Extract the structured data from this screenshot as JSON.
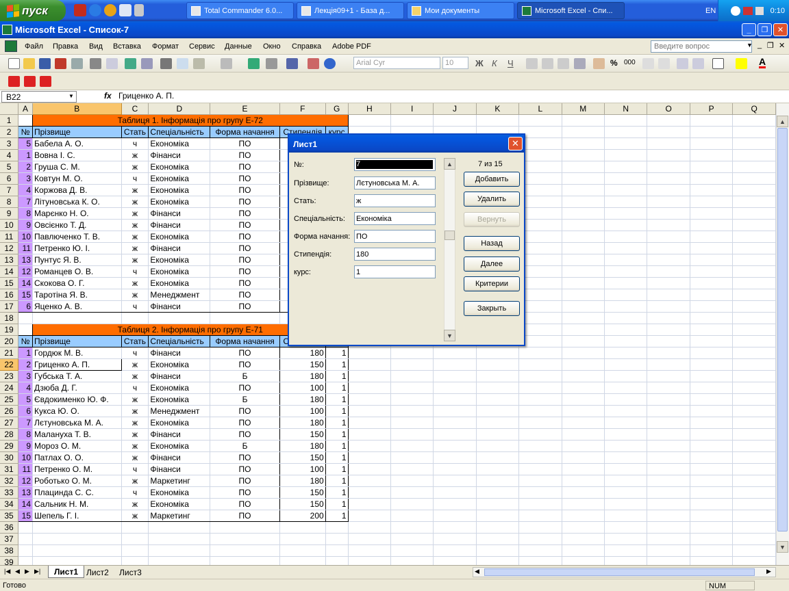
{
  "taskbar": {
    "start_label": "пуск",
    "tasks": [
      {
        "label": "Total Commander 6.0...",
        "active": false
      },
      {
        "label": "Лекція09+1 - База д...",
        "active": false
      },
      {
        "label": "Мои документы",
        "active": false
      },
      {
        "label": "Microsoft Excel - Спи...",
        "active": true
      }
    ],
    "lang": "EN",
    "clock": "0:10"
  },
  "window": {
    "title": "Microsoft Excel - Список-7"
  },
  "menubar": {
    "items": [
      "Файл",
      "Правка",
      "Вид",
      "Вставка",
      "Формат",
      "Сервис",
      "Данные",
      "Окно",
      "Справка",
      "Adobe PDF"
    ],
    "ask_placeholder": "Введите вопрос"
  },
  "toolbar": {
    "font": "Arial Cyr",
    "size": "10"
  },
  "formula_bar": {
    "name_box": "B22",
    "fx": "fx",
    "value": "Гриценко А. П."
  },
  "grid": {
    "columns": [
      "A",
      "B",
      "C",
      "D",
      "E",
      "F",
      "G",
      "H",
      "I",
      "J",
      "K",
      "L",
      "M",
      "N",
      "O",
      "P",
      "Q"
    ],
    "table1_title": "Таблиця 1. Інформація про групу Е-72",
    "table2_title": "Таблиця 2. Інформація про групу Е-71",
    "headers": [
      "№",
      "Прізвище",
      "Стать",
      "Спеціальність",
      "Форма начання",
      "Стипендія",
      "курс"
    ],
    "table1_rows": [
      [
        "5",
        "Бабела А. О.",
        "ч",
        "Економіка",
        "ПО"
      ],
      [
        "1",
        "Вовна І. С.",
        "ж",
        "Фінанси",
        "ПО"
      ],
      [
        "2",
        "Груша С. М.",
        "ж",
        "Економіка",
        "ПО"
      ],
      [
        "3",
        "Ковтун М. О.",
        "ч",
        "Економіка",
        "ПО"
      ],
      [
        "4",
        "Коржова Д. В.",
        "ж",
        "Економіка",
        "ПО"
      ],
      [
        "7",
        "Літуновська К. О.",
        "ж",
        "Економіка",
        "ПО"
      ],
      [
        "8",
        "Марєнко Н. О.",
        "ж",
        "Фінанси",
        "ПО"
      ],
      [
        "9",
        "Овсієнко Т. Д.",
        "ж",
        "Фінанси",
        "ПО"
      ],
      [
        "10",
        "Павлюченко Т. В.",
        "ж",
        "Економіка",
        "ПО"
      ],
      [
        "11",
        "Петренко Ю. І.",
        "ж",
        "Фінанси",
        "ПО"
      ],
      [
        "13",
        "Пунтус Я. В.",
        "ж",
        "Економіка",
        "ПО"
      ],
      [
        "12",
        "Романцев О. В.",
        "ч",
        "Економіка",
        "ПО"
      ],
      [
        "14",
        "Скокова О. Г.",
        "ж",
        "Економіка",
        "ПО"
      ],
      [
        "15",
        "Таротіна Я. В.",
        "ж",
        "Менеджмент",
        "ПО"
      ],
      [
        "6",
        "Яценко А. В.",
        "ч",
        "Фінанси",
        "ПО"
      ]
    ],
    "table2_rows": [
      [
        "1",
        "Гордюк М. В.",
        "ч",
        "Фінанси",
        "ПО",
        "180",
        "1"
      ],
      [
        "2",
        "Гриценко А. П.",
        "ж",
        "Економіка",
        "ПО",
        "150",
        "1"
      ],
      [
        "3",
        "Губська Т. А.",
        "ж",
        "Фінанси",
        "Б",
        "180",
        "1"
      ],
      [
        "4",
        "Дзюба Д. Г.",
        "ч",
        "Економіка",
        "ПО",
        "100",
        "1"
      ],
      [
        "5",
        "Євдокименко Ю. Ф.",
        "ж",
        "Економіка",
        "Б",
        "180",
        "1"
      ],
      [
        "6",
        "Кукса Ю. О.",
        "ж",
        "Менеджмент",
        "ПО",
        "100",
        "1"
      ],
      [
        "7",
        "Лєтуновська М. А.",
        "ж",
        "Економіка",
        "ПО",
        "180",
        "1"
      ],
      [
        "8",
        "Малануха Т. В.",
        "ж",
        "Фінанси",
        "ПО",
        "150",
        "1"
      ],
      [
        "9",
        "Мороз О. М.",
        "ж",
        "Економіка",
        "Б",
        "180",
        "1"
      ],
      [
        "10",
        "Патлах О. О.",
        "ж",
        "Фінанси",
        "ПО",
        "150",
        "1"
      ],
      [
        "11",
        "Петренко О. М.",
        "ч",
        "Фінанси",
        "ПО",
        "100",
        "1"
      ],
      [
        "12",
        "Роботько О. М.",
        "ж",
        "Маркетинг",
        "ПО",
        "180",
        "1"
      ],
      [
        "13",
        "Плацинда С. С.",
        "ч",
        "Економіка",
        "ПО",
        "150",
        "1"
      ],
      [
        "14",
        "Сальник Н. М.",
        "ж",
        "Економіка",
        "ПО",
        "150",
        "1"
      ],
      [
        "15",
        "Шепель Г. І.",
        "ж",
        "Маркетинг",
        "ПО",
        "200",
        "1"
      ]
    ]
  },
  "sheet_tabs": [
    "Лист1",
    "Лист2",
    "Лист3"
  ],
  "status": {
    "left": "Готово",
    "num": "NUM"
  },
  "dialog": {
    "title": "Лист1",
    "counter": "7 из 15",
    "fields": [
      {
        "label": "№:",
        "value": "7"
      },
      {
        "label": "Прізвище:",
        "value": "Лєтуновська М. А."
      },
      {
        "label": "Стать:",
        "value": "ж"
      },
      {
        "label": "Спеціальність:",
        "value": "Економіка"
      },
      {
        "label": "Форма начання:",
        "value": "ПО"
      },
      {
        "label": "Стипендія:",
        "value": "180"
      },
      {
        "label": "курс:",
        "value": "1"
      }
    ],
    "buttons": {
      "add": "Добавить",
      "delete": "Удалить",
      "restore": "Вернуть",
      "prev": "Назад",
      "next": "Далее",
      "criteria": "Критерии",
      "close": "Закрыть"
    }
  }
}
